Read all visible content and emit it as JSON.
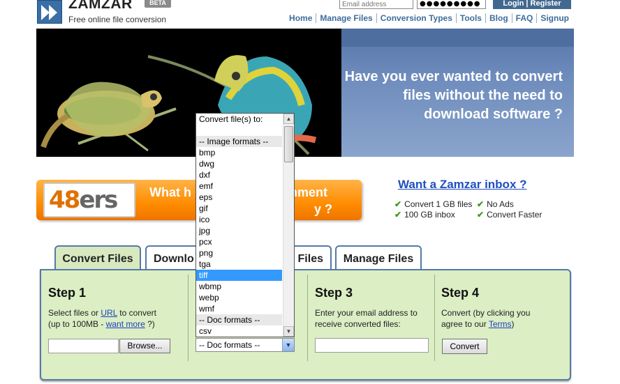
{
  "header": {
    "logo_word": "ZAMZAR",
    "beta_badge": "BETA",
    "tagline": "Free online file conversion",
    "email_placeholder": "Email address",
    "password_mask": "●●●●●●●●●",
    "login_label": "Login",
    "register_label": "Register",
    "login_separator": " | "
  },
  "nav": {
    "items": [
      "Home",
      "Manage Files",
      "Conversion Types",
      "Tools",
      "Blog",
      "FAQ",
      "Signup"
    ]
  },
  "banner": {
    "headline": "Have you ever wanted to convert files without the need to download software ?"
  },
  "ad": {
    "logo_digits": "48",
    "logo_letters": "ers",
    "line1": "What h",
    "line1_tail": "ernment",
    "line2_tail": "y ?"
  },
  "inbox": {
    "title": "Want a Zamzar inbox ?",
    "perks": [
      "Convert 1 GB files",
      "No Ads",
      "100 GB inbox",
      "Convert Faster"
    ],
    "tick": "✔"
  },
  "tabs": [
    {
      "label": "Convert Files",
      "active": true
    },
    {
      "label": "Downlo",
      "active": false
    },
    {
      "label": "Files",
      "active": false
    },
    {
      "label": "Manage Files",
      "active": false
    }
  ],
  "steps": {
    "step1": {
      "title": "Step 1",
      "text_a": "Select files or ",
      "link_url": "URL",
      "text_b": " to convert",
      "text_c": "(up to 100MB - ",
      "link_more": "want more",
      "text_d": " ?)",
      "browse_label": "Browse..."
    },
    "step3": {
      "title": "Step 3",
      "text_1": "Enter your email address to",
      "text_2": "receive converted files:"
    },
    "step4": {
      "title": "Step 4",
      "text_1": "Convert (by clicking you",
      "text_2": "agree to our ",
      "link_terms": "Terms",
      "text_3": ")",
      "convert_label": "Convert"
    }
  },
  "format_dropdown": {
    "selected_value": "-- Doc formats --",
    "arrow": "▼",
    "scroll_up": "▲",
    "scroll_down": "▼",
    "options": [
      {
        "label": "Convert file(s) to:",
        "kind": "header"
      },
      {
        "label": "",
        "kind": "blank"
      },
      {
        "label": "-- Image formats --",
        "kind": "group"
      },
      {
        "label": "bmp",
        "kind": "item"
      },
      {
        "label": "dwg",
        "kind": "item"
      },
      {
        "label": "dxf",
        "kind": "item"
      },
      {
        "label": "emf",
        "kind": "item"
      },
      {
        "label": "eps",
        "kind": "item"
      },
      {
        "label": "gif",
        "kind": "item"
      },
      {
        "label": "ico",
        "kind": "item"
      },
      {
        "label": "jpg",
        "kind": "item"
      },
      {
        "label": "pcx",
        "kind": "item"
      },
      {
        "label": "png",
        "kind": "item"
      },
      {
        "label": "tga",
        "kind": "item"
      },
      {
        "label": "tiff",
        "kind": "selected"
      },
      {
        "label": "wbmp",
        "kind": "item"
      },
      {
        "label": "webp",
        "kind": "item"
      },
      {
        "label": "wmf",
        "kind": "item"
      },
      {
        "label": "-- Doc formats --",
        "kind": "group"
      },
      {
        "label": "csv",
        "kind": "item"
      }
    ]
  },
  "colors": {
    "nav_link": "#3d6d9c",
    "panel_bg": "#dbeec4",
    "tab_border": "#5479a6",
    "selection": "#3399ff",
    "ad_orange": "#ff8c00"
  }
}
